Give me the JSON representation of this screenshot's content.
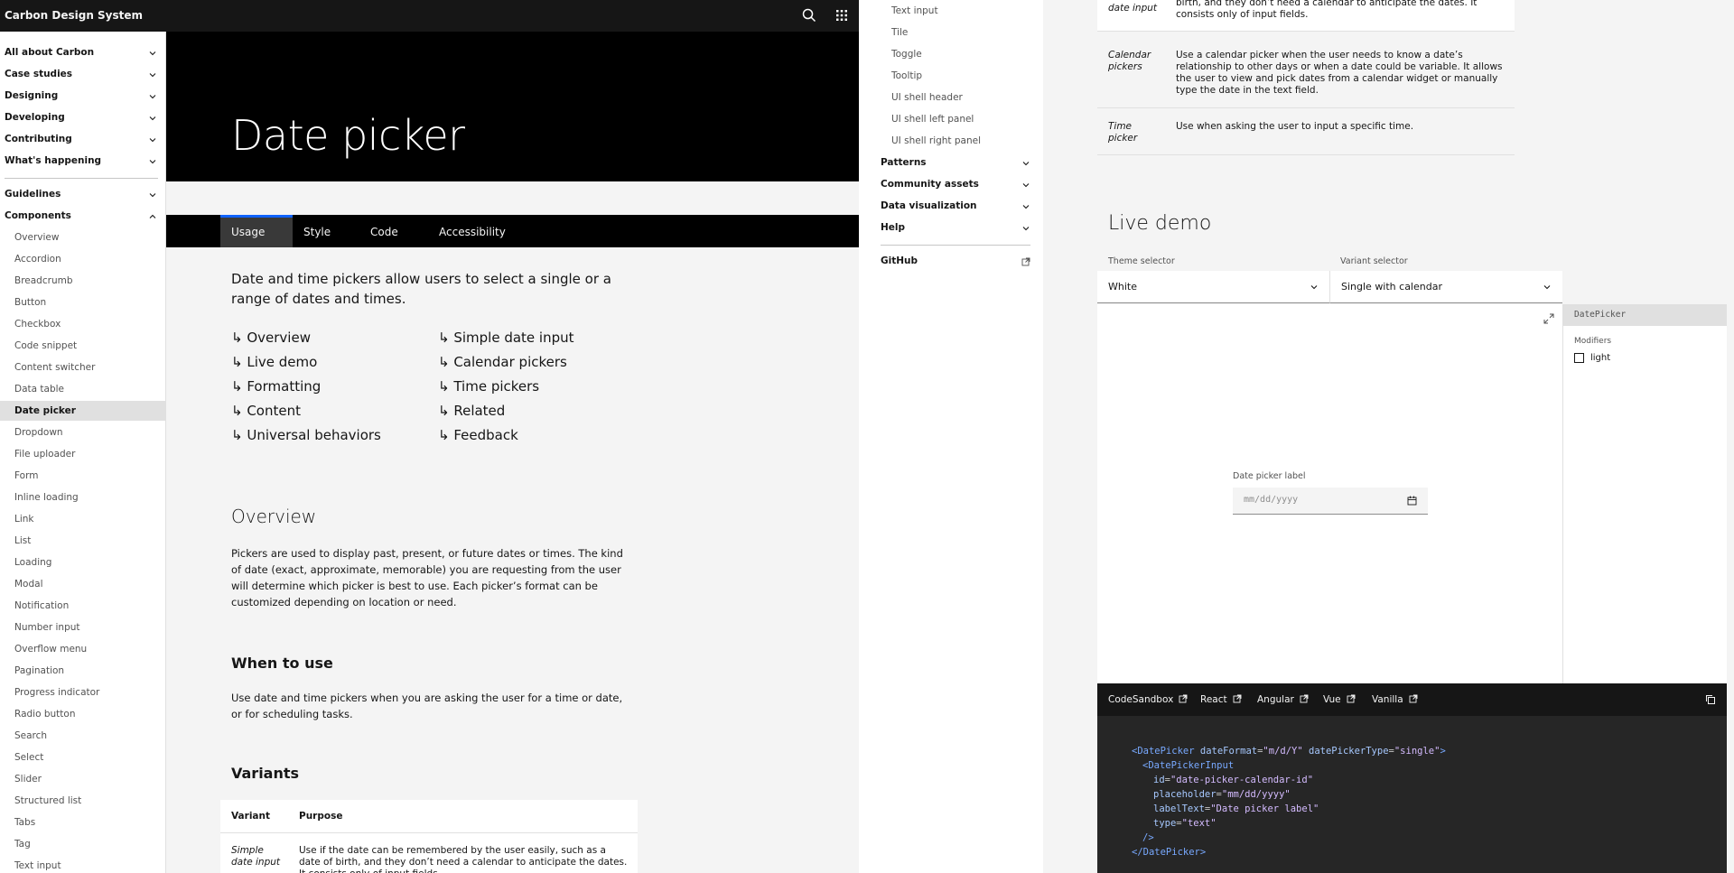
{
  "header": {
    "brand": "Carbon Design System"
  },
  "sidebar": {
    "sections": [
      "All about Carbon",
      "Case studies",
      "Designing",
      "Developing",
      "Contributing",
      "What's happening"
    ],
    "guidelines": "Guidelines",
    "components": "Components",
    "items": [
      "Overview",
      "Accordion",
      "Breadcrumb",
      "Button",
      "Checkbox",
      "Code snippet",
      "Content switcher",
      "Data table",
      "Date picker",
      "Dropdown",
      "File uploader",
      "Form",
      "Inline loading",
      "Link",
      "List",
      "Loading",
      "Modal",
      "Notification",
      "Number input",
      "Overflow menu",
      "Pagination",
      "Progress indicator",
      "Radio button",
      "Search",
      "Select",
      "Slider",
      "Structured list",
      "Tabs",
      "Tag",
      "Text input"
    ],
    "active": "Date picker"
  },
  "page": {
    "title": "Date picker",
    "tabs": [
      "Usage",
      "Style",
      "Code",
      "Accessibility"
    ],
    "active_tab": "Usage",
    "lead": "Date and time pickers allow users to select a single or a range of dates and times.",
    "toc_left": [
      "↳ Overview",
      "↳ Live demo",
      "↳ Formatting",
      "↳ Content",
      "↳ Universal behaviors"
    ],
    "toc_right": [
      "↳ Simple date input",
      "↳ Calendar pickers",
      "↳ Time pickers",
      "↳ Related",
      "↳ Feedback"
    ],
    "overview_heading": "Overview",
    "overview_text": "Pickers are used to display past, present, or future dates or times. The kind of date (exact, approximate, memorable) you are requesting from the user will determine which picker is best to use. Each picker’s format can be customized depending on location or need.",
    "when_heading": "When to use",
    "when_text": "Use date and time pickers when you are asking the user for a time or date, or for scheduling tasks.",
    "variants_heading": "Variants",
    "variants_cols": [
      "Variant",
      "Purpose"
    ],
    "variants_row1_name": "Simple date input",
    "variants_row1_text": "Use if the date can be remembered by the user easily, such as a date of birth, and they don’t need a calendar to anticipate the dates. It consists only of input fields."
  },
  "nav2": {
    "sub_items": [
      "Text input",
      "Tile",
      "Toggle",
      "Tooltip",
      "UI shell header",
      "UI shell left panel",
      "UI shell right panel"
    ],
    "items": [
      "Patterns",
      "Community assets",
      "Data visualization",
      "Help"
    ],
    "github": "GitHub"
  },
  "panel3": {
    "table_rows": [
      {
        "variant": "date input",
        "purpose": "birth, and they don’t need a calendar to anticipate the dates. It consists only of input fields."
      },
      {
        "variant": "Calendar pickers",
        "purpose": "Use a calendar picker when the user needs to know a date’s relationship to other days or when a date could be variable. It allows the user to view and pick dates from a calendar widget or manually type the date in the text field."
      },
      {
        "variant": "Time picker",
        "purpose": "Use when asking the user to input a specific time."
      }
    ],
    "live_demo": "Live demo",
    "theme_label": "Theme selector",
    "theme_value": "White",
    "variant_label": "Variant selector",
    "variant_value": "Single with calendar",
    "component_name": "DatePicker",
    "modifiers_label": "Modifiers",
    "modifier_light": "light",
    "date_label": "Date picker label",
    "date_placeholder": "mm/dd/yyyy",
    "code_links": [
      "CodeSandbox",
      "React",
      "Angular",
      "Vue",
      "Vanilla"
    ],
    "code": {
      "l1_tag": "<DatePicker",
      "l1_a1": "dateFormat",
      "l1_v1": "\"m/d/Y\"",
      "l1_a2": "datePickerType",
      "l1_v2": "\"single\"",
      "l1_end": ">",
      "l2_tag": "<DatePickerInput",
      "l3_attr": "id",
      "l3_val": "\"date-picker-calendar-id\"",
      "l4_attr": "placeholder",
      "l4_val": "\"mm/dd/yyyy\"",
      "l5_attr": "labelText",
      "l5_val": "\"Date picker label\"",
      "l6_attr": "type",
      "l6_val": "\"text\"",
      "l7": "/>",
      "l8": "</DatePicker>"
    }
  }
}
